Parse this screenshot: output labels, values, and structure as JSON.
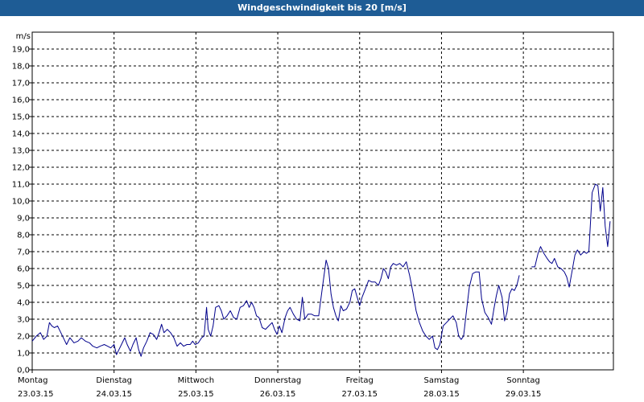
{
  "title": "Windgeschwindigkeit bis 20 [m/s]",
  "colors": {
    "titlebar": "#1e5c95",
    "line": "#00008b",
    "grid": "#000000"
  },
  "chart_data": {
    "type": "line",
    "title": "Windgeschwindigkeit bis 20 [m/s]",
    "ylabel": "m/s",
    "ylim": [
      0,
      20
    ],
    "yticks": [
      "0,0",
      "1,0",
      "2,0",
      "3,0",
      "4,0",
      "5,0",
      "6,0",
      "7,0",
      "8,0",
      "9,0",
      "10,0",
      "11,0",
      "12,0",
      "13,0",
      "14,0",
      "15,0",
      "16,0",
      "17,0",
      "18,0",
      "19,0"
    ],
    "xlim": [
      0,
      7.1
    ],
    "grid": true,
    "days": [
      {
        "name": "Montag",
        "date": "23.03.15"
      },
      {
        "name": "Dienstag",
        "date": "24.03.15"
      },
      {
        "name": "Mittwoch",
        "date": "25.03.15"
      },
      {
        "name": "Donnerstag",
        "date": "26.03.15"
      },
      {
        "name": "Freitag",
        "date": "27.03.15"
      },
      {
        "name": "Samstag",
        "date": "28.03.15"
      },
      {
        "name": "Sonntag",
        "date": "29.03.15"
      }
    ],
    "series": [
      {
        "segments": [
          [
            [
              0.0,
              1.7
            ],
            [
              0.05,
              2.0
            ],
            [
              0.1,
              2.2
            ],
            [
              0.14,
              1.8
            ],
            [
              0.18,
              2.0
            ],
            [
              0.21,
              2.8
            ],
            [
              0.24,
              2.6
            ],
            [
              0.27,
              2.5
            ],
            [
              0.31,
              2.6
            ],
            [
              0.35,
              2.2
            ],
            [
              0.39,
              1.8
            ],
            [
              0.42,
              1.5
            ],
            [
              0.46,
              1.9
            ],
            [
              0.51,
              1.6
            ],
            [
              0.56,
              1.7
            ],
            [
              0.6,
              1.9
            ],
            [
              0.65,
              1.7
            ],
            [
              0.7,
              1.6
            ],
            [
              0.74,
              1.4
            ],
            [
              0.79,
              1.3
            ],
            [
              0.83,
              1.4
            ],
            [
              0.88,
              1.5
            ],
            [
              0.92,
              1.4
            ],
            [
              0.96,
              1.3
            ],
            [
              1.0,
              1.5
            ],
            [
              1.03,
              0.9
            ],
            [
              1.06,
              1.2
            ],
            [
              1.1,
              1.6
            ],
            [
              1.13,
              1.9
            ],
            [
              1.16,
              1.5
            ],
            [
              1.2,
              1.1
            ],
            [
              1.23,
              1.5
            ],
            [
              1.27,
              1.9
            ],
            [
              1.3,
              1.2
            ],
            [
              1.33,
              0.8
            ],
            [
              1.36,
              1.3
            ],
            [
              1.4,
              1.7
            ],
            [
              1.44,
              2.2
            ],
            [
              1.48,
              2.1
            ],
            [
              1.52,
              1.8
            ],
            [
              1.55,
              2.2
            ],
            [
              1.58,
              2.7
            ],
            [
              1.61,
              2.2
            ],
            [
              1.65,
              2.4
            ],
            [
              1.69,
              2.2
            ],
            [
              1.73,
              1.9
            ],
            [
              1.77,
              1.4
            ],
            [
              1.81,
              1.6
            ],
            [
              1.85,
              1.4
            ],
            [
              1.89,
              1.5
            ],
            [
              1.93,
              1.5
            ],
            [
              1.96,
              1.7
            ],
            [
              1.99,
              1.5
            ],
            [
              2.03,
              1.6
            ],
            [
              2.07,
              1.9
            ],
            [
              2.1,
              2.0
            ],
            [
              2.13,
              3.7
            ],
            [
              2.15,
              2.4
            ],
            [
              2.18,
              2.0
            ],
            [
              2.21,
              2.6
            ],
            [
              2.24,
              3.7
            ],
            [
              2.28,
              3.8
            ],
            [
              2.31,
              3.5
            ],
            [
              2.34,
              3.0
            ],
            [
              2.38,
              3.2
            ],
            [
              2.42,
              3.5
            ],
            [
              2.46,
              3.1
            ],
            [
              2.5,
              3.0
            ],
            [
              2.54,
              3.7
            ],
            [
              2.58,
              3.8
            ],
            [
              2.62,
              4.1
            ],
            [
              2.65,
              3.7
            ],
            [
              2.68,
              4.0
            ],
            [
              2.71,
              3.7
            ],
            [
              2.74,
              3.2
            ],
            [
              2.77,
              3.1
            ],
            [
              2.81,
              2.5
            ],
            [
              2.85,
              2.4
            ],
            [
              2.89,
              2.6
            ],
            [
              2.93,
              2.8
            ],
            [
              2.96,
              2.4
            ],
            [
              2.99,
              2.1
            ],
            [
              3.02,
              2.6
            ],
            [
              3.05,
              2.2
            ],
            [
              3.09,
              3.1
            ],
            [
              3.12,
              3.5
            ],
            [
              3.15,
              3.7
            ],
            [
              3.19,
              3.3
            ],
            [
              3.23,
              3.0
            ],
            [
              3.27,
              2.9
            ],
            [
              3.3,
              4.3
            ],
            [
              3.33,
              3.0
            ],
            [
              3.37,
              3.3
            ],
            [
              3.41,
              3.3
            ],
            [
              3.45,
              3.2
            ],
            [
              3.5,
              3.2
            ],
            [
              3.54,
              4.7
            ],
            [
              3.59,
              6.5
            ],
            [
              3.62,
              6.0
            ],
            [
              3.65,
              4.5
            ],
            [
              3.68,
              3.7
            ],
            [
              3.71,
              3.2
            ],
            [
              3.74,
              2.9
            ],
            [
              3.77,
              3.8
            ],
            [
              3.8,
              3.5
            ],
            [
              3.84,
              3.6
            ],
            [
              3.88,
              4.0
            ],
            [
              3.91,
              4.7
            ],
            [
              3.94,
              4.8
            ],
            [
              3.97,
              4.3
            ],
            [
              4.0,
              3.8
            ],
            [
              4.03,
              4.3
            ],
            [
              4.07,
              4.8
            ],
            [
              4.11,
              5.3
            ],
            [
              4.15,
              5.2
            ],
            [
              4.19,
              5.2
            ],
            [
              4.23,
              5.0
            ],
            [
              4.26,
              5.4
            ],
            [
              4.29,
              6.0
            ],
            [
              4.32,
              5.8
            ],
            [
              4.35,
              5.4
            ],
            [
              4.38,
              6.1
            ],
            [
              4.41,
              6.3
            ],
            [
              4.45,
              6.2
            ],
            [
              4.49,
              6.3
            ],
            [
              4.53,
              6.1
            ],
            [
              4.57,
              6.4
            ],
            [
              4.61,
              5.6
            ],
            [
              4.65,
              4.6
            ],
            [
              4.69,
              3.5
            ],
            [
              4.73,
              2.8
            ],
            [
              4.77,
              2.3
            ],
            [
              4.81,
              2.0
            ],
            [
              4.85,
              1.8
            ],
            [
              4.89,
              2.0
            ],
            [
              4.92,
              1.3
            ],
            [
              4.95,
              1.2
            ],
            [
              4.98,
              1.5
            ],
            [
              5.02,
              2.6
            ],
            [
              5.06,
              2.8
            ],
            [
              5.1,
              3.0
            ],
            [
              5.14,
              3.2
            ],
            [
              5.18,
              2.8
            ],
            [
              5.21,
              2.0
            ],
            [
              5.24,
              1.8
            ],
            [
              5.27,
              2.0
            ],
            [
              5.31,
              3.7
            ],
            [
              5.34,
              4.9
            ],
            [
              5.38,
              5.7
            ],
            [
              5.42,
              5.8
            ],
            [
              5.46,
              5.8
            ],
            [
              5.49,
              4.2
            ],
            [
              5.53,
              3.4
            ],
            [
              5.57,
              3.1
            ],
            [
              5.61,
              2.7
            ],
            [
              5.64,
              3.6
            ],
            [
              5.67,
              4.4
            ],
            [
              5.7,
              5.0
            ],
            [
              5.74,
              4.3
            ],
            [
              5.77,
              2.9
            ],
            [
              5.8,
              3.4
            ],
            [
              5.83,
              4.5
            ],
            [
              5.86,
              4.8
            ],
            [
              5.89,
              4.7
            ],
            [
              5.92,
              5.0
            ],
            [
              5.95,
              5.6
            ]
          ],
          [
            [
              6.1,
              6.1
            ],
            [
              6.14,
              6.1
            ],
            [
              6.18,
              6.9
            ],
            [
              6.21,
              7.3
            ],
            [
              6.25,
              6.9
            ],
            [
              6.29,
              6.6
            ],
            [
              6.32,
              6.4
            ],
            [
              6.35,
              6.3
            ],
            [
              6.38,
              6.6
            ],
            [
              6.42,
              6.1
            ],
            [
              6.46,
              6.0
            ],
            [
              6.5,
              5.8
            ],
            [
              6.53,
              5.5
            ],
            [
              6.56,
              4.9
            ],
            [
              6.59,
              5.7
            ],
            [
              6.63,
              6.8
            ],
            [
              6.66,
              7.1
            ],
            [
              6.7,
              6.8
            ],
            [
              6.74,
              7.0
            ],
            [
              6.77,
              6.9
            ],
            [
              6.8,
              7.0
            ],
            [
              6.84,
              10.5
            ],
            [
              6.88,
              11.0
            ],
            [
              6.91,
              10.9
            ],
            [
              6.94,
              9.4
            ],
            [
              6.97,
              10.8
            ],
            [
              7.0,
              8.5
            ],
            [
              7.03,
              7.3
            ],
            [
              7.06,
              8.8
            ]
          ]
        ]
      }
    ]
  }
}
